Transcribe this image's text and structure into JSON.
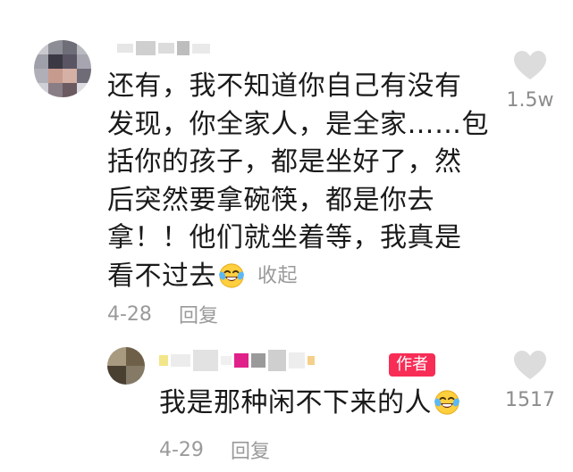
{
  "main_comment": {
    "text_lines": [
      "还有，我不知道你自己有没有",
      "发现，你全家人，是全家……包",
      "括你的孩子，都是坐好了，然",
      "后突然要拿碗筷，都是你去",
      "拿！！他们就坐着等，我真是",
      "看不过去"
    ],
    "emoji": "laugh-cry-emoji",
    "collapse_label": "收起",
    "date": "4-28",
    "reply_label": "回复",
    "like_count": "1.5w"
  },
  "reply_comment": {
    "author_badge": "作者",
    "text": "我是那种闲不下来的人",
    "emoji": "laugh-cry-emoji",
    "date": "4-29",
    "reply_label": "回复",
    "like_count": "1517"
  },
  "colors": {
    "text": "#1a1a1a",
    "meta": "#9a9a9a",
    "like_icon": "#dcdcdc",
    "badge": "#f72d56"
  }
}
